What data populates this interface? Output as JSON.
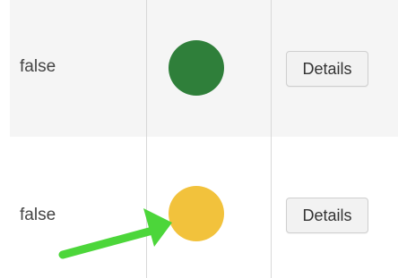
{
  "rows": [
    {
      "value": "false",
      "status_color": "#2f7f3a",
      "action_label": "Details"
    },
    {
      "value": "false",
      "status_color": "#f2c23c",
      "action_label": "Details"
    }
  ],
  "annotation": {
    "arrow_color": "#4cd63a",
    "points_to": "row-2 status indicator"
  }
}
